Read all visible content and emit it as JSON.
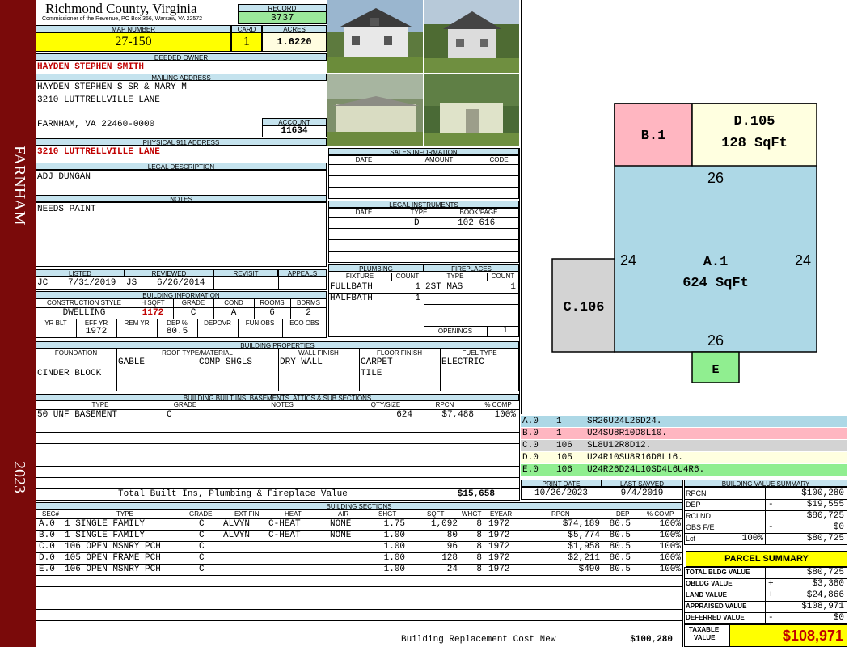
{
  "sidebar": {
    "location": "FARNHAM",
    "year": "2023"
  },
  "header": {
    "county": "Richmond County, Virginia",
    "commissioner": "Commissioner of the Revenue, PO Box 366, Warsaw, VA 22572",
    "record_label": "RECORD",
    "record": "3737",
    "map_number_label": "MAP NUMBER",
    "map_number": "27-150",
    "card_label": "CARD",
    "card": "1",
    "acres_label": "ACRES",
    "acres": "1.6220"
  },
  "owner": {
    "deeded_owner_label": "DEEDED OWNER",
    "deeded_owner": "HAYDEN STEPHEN SMITH",
    "mailing_label": "MAILING ADDRESS",
    "mailing_line1": "HAYDEN STEPHEN S SR & MARY M",
    "mailing_line2": "3210 LUTTRELLVILLE LANE",
    "mailing_line3": "FARNHAM, VA 22460-0000",
    "account_label": "ACCOUNT",
    "account": "11634",
    "physical_label": "PHYSICAL 911 ADDRESS",
    "physical": "3210 LUTTRELLVILLE LANE",
    "legal_label": "LEGAL DESCRIPTION",
    "legal": "ADJ DUNGAN",
    "notes_label": "NOTES",
    "notes": "NEEDS PAINT"
  },
  "sales": {
    "title": "SALES INFORMATION",
    "cols": [
      "DATE",
      "AMOUNT",
      "CODE"
    ]
  },
  "legal_instruments": {
    "title": "LEGAL INSTRUMENTS",
    "cols": [
      "DATE",
      "TYPE",
      "BOOK/PAGE"
    ],
    "row_type": "D",
    "row_book": "102 616"
  },
  "listing": {
    "listed_label": "LISTED",
    "reviewed_label": "REVIEWED",
    "revisit_label": "REVISIT",
    "appeals_label": "APPEALS",
    "listed_by": "JC",
    "listed_date": "7/31/2019",
    "reviewed_by": "JS",
    "reviewed_date": "6/26/2014"
  },
  "building_info": {
    "title": "BUILDING INFORMATION",
    "cols": [
      "CONSTRUCTION STYLE",
      "H SQFT",
      "GRADE",
      "COND",
      "ROOMS",
      "BDRMS"
    ],
    "style": "DWELLING",
    "hsqft": "1172",
    "grade": "C",
    "cond": "A",
    "rooms": "6",
    "bdrms": "2",
    "cols2": [
      "YR BLT",
      "EFF YR",
      "REM YR",
      "DEP %",
      "DEPOVR",
      "FUN OBS",
      "ECO OBS"
    ],
    "eff_yr": "1972",
    "dep": "80.5"
  },
  "plumbing": {
    "title": "PLUMBING",
    "cols": [
      "FIXTURE",
      "COUNT"
    ],
    "rows": [
      {
        "fixture": "FULLBATH",
        "count": "1"
      },
      {
        "fixture": "HALFBATH",
        "count": "1"
      }
    ]
  },
  "fireplaces": {
    "title": "FIREPLACES",
    "cols": [
      "TYPE",
      "COUNT"
    ],
    "type": "2ST MAS",
    "count": "1",
    "openings_label": "OPENINGS",
    "openings": "1"
  },
  "properties": {
    "title": "BUILDING PROPERTIES",
    "cols": [
      "FOUNDATION",
      "ROOF TYPE/MATERIAL",
      "WALL FINISH",
      "FLOOR FINISH",
      "FUEL TYPE"
    ],
    "foundation": "CINDER BLOCK",
    "roof_type": "GABLE",
    "roof_material": "COMP SHGLS",
    "wall": "DRY WALL",
    "floor1": "CARPET",
    "floor2": "TILE",
    "fuel": "ELECTRIC"
  },
  "builtins": {
    "title": "BUILDING BUILT INS, BASEMENTS, ATTICS & SUB SECTIONS",
    "cols": [
      "TYPE",
      "GRADE",
      "NOTES",
      "QTY/SIZE",
      "RPCN",
      "% COMP"
    ],
    "row": {
      "type": "50 UNF BASEMENT",
      "grade": "C",
      "qty": "624",
      "rpcn": "$7,488",
      "comp": "100%"
    },
    "total_label": "Total Built Ins, Plumbing & Fireplace Value",
    "total": "$15,658"
  },
  "print": {
    "print_label": "PRINT DATE",
    "survey_label": "LAST SAVVED",
    "print_date": "10/26/2023",
    "survey_date": "9/4/2019"
  },
  "sections": {
    "title": "BUILDING SECTIONS",
    "cols": [
      "SEC#",
      "TYPE",
      "GRADE",
      "EXT FIN",
      "HEAT",
      "AIR",
      "SHGT",
      "SQFT",
      "WHGT",
      "EYEAR",
      "RPCN",
      "DEP",
      "% COMP"
    ],
    "rows": [
      {
        "sec": "A.0",
        "type": "1 SINGLE FAMILY",
        "grade": "C",
        "ext": "ALVYN",
        "heat": "C-HEAT",
        "air": "NONE",
        "shgt": "1.75",
        "sqft": "1,092",
        "whgt": "8",
        "eyear": "1972",
        "rpcn": "$74,189",
        "dep": "80.5",
        "comp": "100%"
      },
      {
        "sec": "B.0",
        "type": "1 SINGLE FAMILY",
        "grade": "C",
        "ext": "ALVYN",
        "heat": "C-HEAT",
        "air": "NONE",
        "shgt": "1.00",
        "sqft": "80",
        "whgt": "8",
        "eyear": "1972",
        "rpcn": "$5,774",
        "dep": "80.5",
        "comp": "100%"
      },
      {
        "sec": "C.0",
        "type": "106 OPEN MSNRY PCH",
        "grade": "C",
        "ext": "",
        "heat": "",
        "air": "",
        "shgt": "1.00",
        "sqft": "96",
        "whgt": "8",
        "eyear": "1972",
        "rpcn": "$1,958",
        "dep": "80.5",
        "comp": "100%"
      },
      {
        "sec": "D.0",
        "type": "105 OPEN FRAME PCH",
        "grade": "C",
        "ext": "",
        "heat": "",
        "air": "",
        "shgt": "1.00",
        "sqft": "128",
        "whgt": "8",
        "eyear": "1972",
        "rpcn": "$2,211",
        "dep": "80.5",
        "comp": "100%"
      },
      {
        "sec": "E.0",
        "type": "106 OPEN MSNRY PCH",
        "grade": "C",
        "ext": "",
        "heat": "",
        "air": "",
        "shgt": "1.00",
        "sqft": "24",
        "whgt": "8",
        "eyear": "1972",
        "rpcn": "$490",
        "dep": "80.5",
        "comp": "100%"
      }
    ],
    "replacement_label": "Building Replacement Cost New",
    "replacement": "$100,280"
  },
  "sketch": {
    "a_label": "A.1",
    "a_area": "624 SqFt",
    "b_label": "B.1",
    "c_label": "C.106",
    "d_label": "D.105",
    "d_area": "128 SqFt",
    "e_label": "E",
    "top": "26",
    "bottom": "26",
    "left": "24",
    "right": "24"
  },
  "vectors": [
    {
      "sec": "A.0",
      "code": "1",
      "vec": "SR26U24L26D24.",
      "color": "#add8e6"
    },
    {
      "sec": "B.0",
      "code": "1",
      "vec": "U24SU8R10D8L10.",
      "color": "#ffb6c1"
    },
    {
      "sec": "C.0",
      "code": "106",
      "vec": "SL8U12R8D12.",
      "color": "#d3d3d3"
    },
    {
      "sec": "D.0",
      "code": "105",
      "vec": "U24R10SU8R16D8L16.",
      "color": "#ffffe0"
    },
    {
      "sec": "E.0",
      "code": "106",
      "vec": "U24R26D24L10SD4L6U4R6.",
      "color": "#90ee90"
    }
  ],
  "bldg_value": {
    "title": "BUILDING VALUE SUMMARY",
    "rpcn_label": "RPCN",
    "rpcn": "$100,280",
    "dep_label": "DEP",
    "dep_sign": "-",
    "dep": "$19,555",
    "rclnd_label": "RCLND",
    "rclnd": "$80,725",
    "obs_label": "OBS F/E",
    "obs_sign": "-",
    "obs": "$0",
    "lcf_label": "Lcf",
    "lcf_pct": "100%",
    "lcf": "$80,725"
  },
  "parcel": {
    "title": "PARCEL SUMMARY",
    "total_bldg_label": "TOTAL BLDG VALUE",
    "total_bldg": "$80,725",
    "obldg_label": "OBLDG VALUE",
    "obldg_sign": "+",
    "obldg": "$3,380",
    "land_label": "LAND VALUE",
    "land_sign": "+",
    "land": "$24,866",
    "appraised_label": "APPRAISED VALUE",
    "appraised": "$108,971",
    "deferred_label": "DEFERRED VALUE",
    "deferred_sign": "-",
    "deferred": "$0",
    "taxable_label1": "TAXABLE",
    "taxable_label2": "VALUE",
    "taxable": "$108,971"
  }
}
